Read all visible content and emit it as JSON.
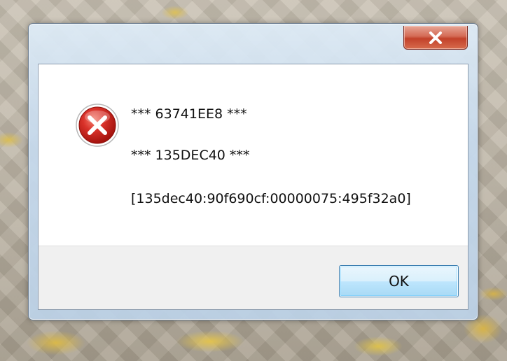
{
  "dialog": {
    "close_icon": "close-x-icon",
    "error_icon": "error-x-icon",
    "messages": [
      "*** 63741EE8 ***",
      "*** 135DEC40 ***",
      "[135dec40:90f690cf:00000075:495f32a0]"
    ],
    "ok_label": "OK"
  },
  "colors": {
    "close_button": "#c2412a",
    "error_icon_red": "#c91f16",
    "ok_border": "#3c7fb1",
    "button_bar": "#f0f0f0"
  }
}
